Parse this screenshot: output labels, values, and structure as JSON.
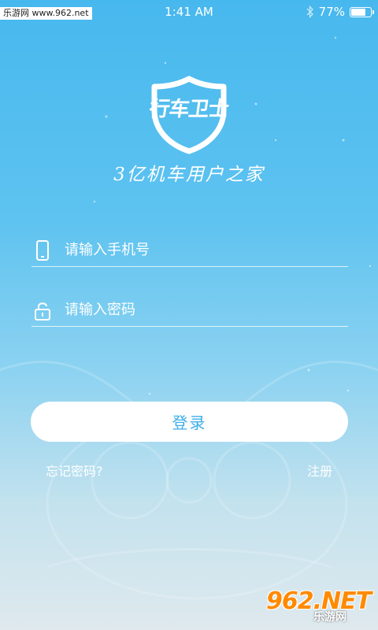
{
  "status_bar": {
    "watermark": "乐游网 www.962.net",
    "time": "1:41 AM",
    "bluetooth_icon": "bluetooth-icon",
    "battery_percent": "77%",
    "battery_level": 0.77
  },
  "logo": {
    "text": "行车卫士",
    "icon": "shield-icon"
  },
  "slogan": "3亿机车用户之家",
  "phone_field": {
    "icon": "phone-icon",
    "placeholder": "请输入手机号",
    "value": ""
  },
  "password_field": {
    "icon": "lock-icon",
    "placeholder": "请输入密码",
    "value": ""
  },
  "login_button": "登录",
  "forgot_password": "忘记密码?",
  "register": "注册",
  "watermark_bottom": {
    "brand": "962.NET",
    "name": "乐游网"
  },
  "colors": {
    "accent": "#3daee9",
    "background_top": "#47b8ee",
    "background_bottom": "#dfe9ee",
    "button_bg": "#ffffff",
    "watermark_orange": "#ff8a00"
  }
}
